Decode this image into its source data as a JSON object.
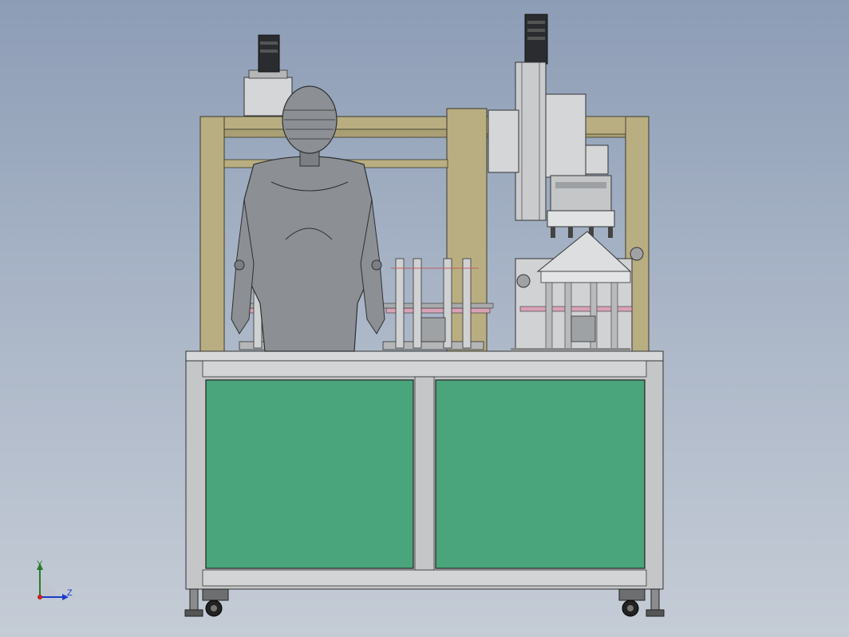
{
  "viewport": {
    "background_top": "#8d9db6",
    "background_bottom": "#c5ccd6"
  },
  "triad": {
    "y_label": "Y",
    "z_label": "Z",
    "y_color": "#2a7a2a",
    "z_color": "#1a3cc8",
    "origin_color": "#c82020"
  },
  "colors": {
    "frame_khaki": "#b9ae82",
    "cabinet_frame": "#c4c6c8",
    "door_panel": "#4aa57c",
    "mannequin": "#8c8f93",
    "motor_dark": "#2a2c30",
    "metal_light": "#d4d6d8",
    "accent_pink": "#d9a3b5"
  },
  "components": [
    {
      "name": "machine-base-cabinet"
    },
    {
      "name": "left-cabinet-door"
    },
    {
      "name": "right-cabinet-door"
    },
    {
      "name": "gantry-frame"
    },
    {
      "name": "operator-mannequin"
    },
    {
      "name": "vertical-linear-module"
    },
    {
      "name": "servo-motor-left"
    },
    {
      "name": "servo-motor-right"
    },
    {
      "name": "fixture-station-1"
    },
    {
      "name": "fixture-station-2"
    },
    {
      "name": "fixture-station-3"
    },
    {
      "name": "caster-wheels"
    }
  ]
}
